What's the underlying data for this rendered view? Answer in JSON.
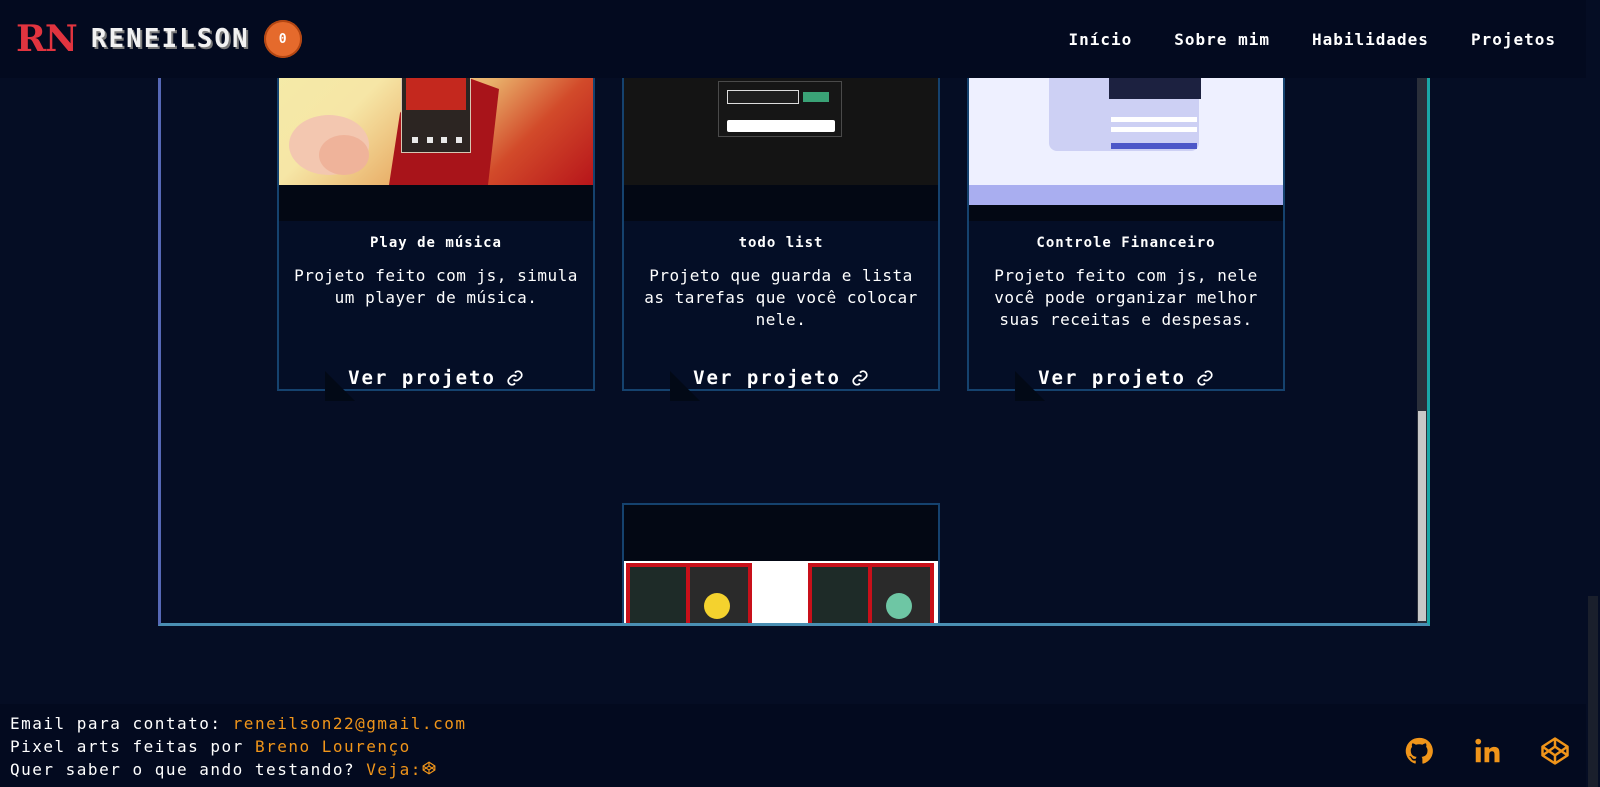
{
  "brand": {
    "mark": "RN",
    "name": "RENEILSON",
    "badge": "0"
  },
  "nav": [
    {
      "label": "Início"
    },
    {
      "label": "Sobre mim"
    },
    {
      "label": "Habilidades"
    },
    {
      "label": "Projetos"
    }
  ],
  "projects": [
    {
      "title": "Play de música",
      "description": "Projeto feito com js, simula um player de música.",
      "link": "Ver projeto"
    },
    {
      "title": "todo list",
      "description": "Projeto que guarda e lista as tarefas que você colocar nele.",
      "link": "Ver projeto"
    },
    {
      "title": "Controle Financeiro",
      "description": "Projeto feito com js, nele você pode organizar melhor suas receitas e despesas.",
      "link": "Ver projeto"
    }
  ],
  "footer": {
    "email_label": "Email para contato:",
    "email": "reneilson22@gmail.com",
    "pixel_label": "Pixel arts feitas por",
    "pixel_author": "Breno Lourenço",
    "testing_label": "Quer saber o que ando testando?",
    "testing_link": "Veja:",
    "social": [
      {
        "name": "github-icon"
      },
      {
        "name": "linkedin-icon"
      },
      {
        "name": "codepen-icon"
      }
    ]
  },
  "colors": {
    "background": "#050d24",
    "accent": "#f0951a",
    "brand_red": "#e1343f",
    "badge_orange": "#e56a2c",
    "card_border": "#15426e"
  }
}
